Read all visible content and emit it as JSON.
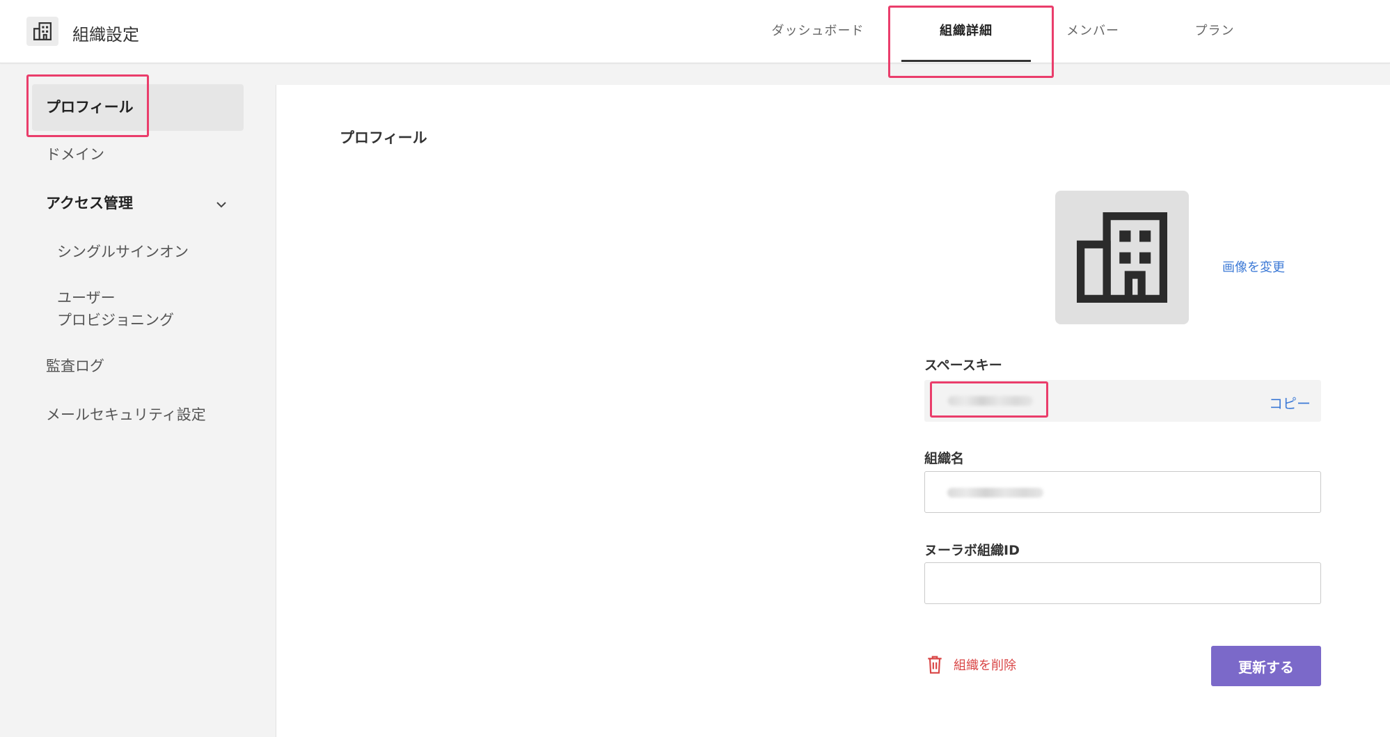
{
  "header": {
    "app_icon": "building-icon",
    "title": "組織設定",
    "tabs": [
      {
        "label": "ダッシュボード"
      },
      {
        "label": "組織詳細",
        "active": true
      },
      {
        "label": "メンバー"
      },
      {
        "label": "プラン"
      }
    ]
  },
  "sidebar": {
    "items": [
      {
        "label": "プロフィール",
        "active": true
      },
      {
        "label": "ドメイン"
      },
      {
        "label": "アクセス管理",
        "expanded": true,
        "icon": "chevron-down-icon"
      },
      {
        "label": "シングルサインオン"
      },
      {
        "label_line1": "ユーザー",
        "label_line2": "プロビジョニング"
      },
      {
        "label": "監査ログ"
      },
      {
        "label": "メールセキュリティ設定"
      }
    ]
  },
  "main": {
    "section_title": "プロフィール",
    "image": {
      "icon": "building-icon",
      "change_label": "画像を変更"
    },
    "space_key": {
      "label": "スペースキー",
      "copy_label": "コピー"
    },
    "org_name": {
      "label": "組織名"
    },
    "nulab_id": {
      "label": "ヌーラボ組織ID",
      "value": ""
    },
    "delete_label": "組織を削除",
    "delete_icon": "trash-icon",
    "update_label": "更新する"
  },
  "colors": {
    "accent": "#7b69c9",
    "link": "#3d7ad6",
    "danger": "#d94545",
    "highlight": "#ea3d6b"
  }
}
